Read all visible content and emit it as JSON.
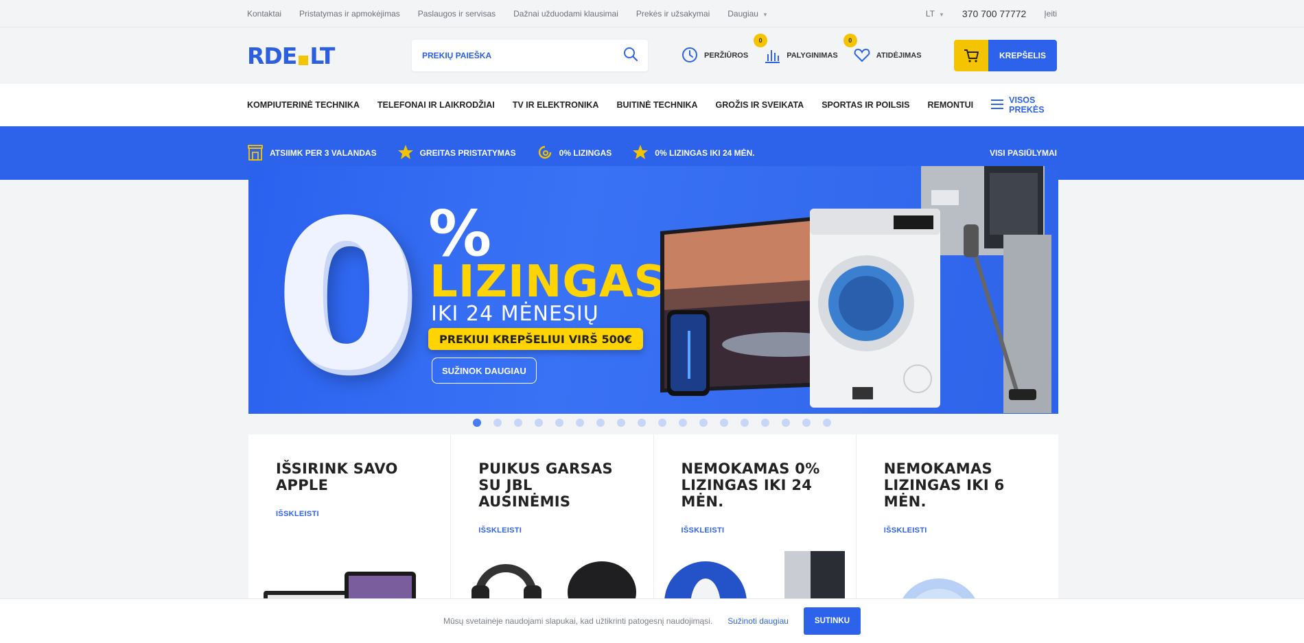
{
  "topbar": {
    "links": [
      "Kontaktai",
      "Pristatymas ir apmokėjimas",
      "Paslaugos ir servisas",
      "Dažnai užduodami klausimai",
      "Prekės ir užsakymai",
      "Daugiau"
    ],
    "language": "LT",
    "phone": "370 700 77772",
    "login": "Įeiti"
  },
  "header": {
    "logo_left": "RDE",
    "logo_right": "LT",
    "search_placeholder": "PREKIŲ PAIEŠKA",
    "views_label": "PERŽIŪROS",
    "compare_label": "PALYGINIMAS",
    "compare_count": "0",
    "wishlist_label": "ATIDĖJIMAS",
    "wishlist_count": "0",
    "cart_label": "KREPŠELIS"
  },
  "categories": [
    "KOMPIUTERINĖ TECHNIKA",
    "TELEFONAI IR LAIKRODŽIAI",
    "TV IR ELEKTRONIKA",
    "BUITINĖ TECHNIKA",
    "GROŽIS IR SVEIKATA",
    "SPORTAS IR POILSIS",
    "REMONTUI"
  ],
  "all_products": "VISOS PREKĖS",
  "strip": {
    "items": [
      "ATSIIMK PER 3 VALANDAS",
      "GREITAS PRISTATYMAS",
      "0% LIZINGAS",
      "0% LIZINGAS IKI 24 MĖN."
    ],
    "offers": "VISI PASIŪLYMAI"
  },
  "banner": {
    "big": "0",
    "percent": "%",
    "headline": "LIZINGAS",
    "sub": "IKI 24 MĖNESIŲ",
    "pill_text": "PREKIUI KREPŠELIUI",
    "pill_bold": "VIRŠ 500€",
    "button": "SUŽINOK DAUGIAU"
  },
  "carousel": {
    "count": 18,
    "active": 0
  },
  "cards": [
    {
      "title": "IŠSIRINK SAVO APPLE",
      "more": "IŠSKLEISTI"
    },
    {
      "title": "PUIKUS GARSAS SU JBL AUSINĖMIS",
      "more": "IŠSKLEISTI"
    },
    {
      "title": "NEMOKAMAS 0% LIZINGAS IKI 24 MĖN.",
      "more": "IŠSKLEISTI"
    },
    {
      "title": "NEMOKAMAS LIZINGAS IKI 6 MĖN.",
      "more": "IŠSKLEISTI"
    }
  ],
  "cookie": {
    "text": "Mūsų svetainėje naudojami slapukai, kad užtikrinti patogesnį naudojimąsi.",
    "link": "Sužinoti daugiau",
    "button": "SUTINKU"
  },
  "colors": {
    "brand_blue": "#2d62ea",
    "brand_yellow": "#f5c400"
  }
}
